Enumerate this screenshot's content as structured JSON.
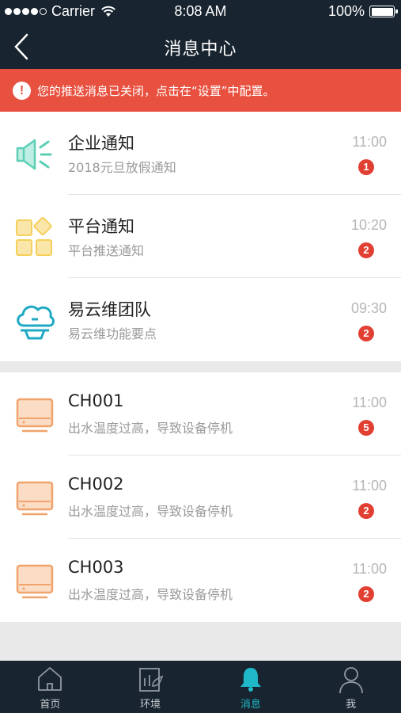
{
  "status_bar": {
    "carrier": "Carrier",
    "time": "8:08 AM",
    "battery": "100%",
    "battery_level": 1.0
  },
  "nav": {
    "back_icon": "chevron-left-icon",
    "title": "消息中心"
  },
  "alert": {
    "icon": "exclamation-icon",
    "text": "您的推送消息已关闭，点击在“设置”中配置。",
    "color": "#e8503f"
  },
  "system_messages": [
    {
      "icon": "megaphone-icon",
      "title": "企业通知",
      "subtitle": "2018元旦放假通知",
      "time": "11:00",
      "badge": "1"
    },
    {
      "icon": "grid-icon",
      "title": "平台通知",
      "subtitle": "平台推送通知",
      "time": "10:20",
      "badge": "2"
    },
    {
      "icon": "cloud-icon",
      "title": "易云维团队",
      "subtitle": "易云维功能要点",
      "time": "09:30",
      "badge": "2"
    }
  ],
  "device_messages": [
    {
      "icon": "device-icon",
      "title": "CH001",
      "subtitle": "出水温度过高，导致设备停机",
      "time": "11:00",
      "badge": "5"
    },
    {
      "icon": "device-icon",
      "title": "CH002",
      "subtitle": "出水温度过高，导致设备停机",
      "time": "11:00",
      "badge": "2"
    },
    {
      "icon": "device-icon",
      "title": "CH003",
      "subtitle": "出水温度过高，导致设备停机",
      "time": "11:00",
      "badge": "2"
    }
  ],
  "tabs": [
    {
      "label": "首页",
      "icon": "home-icon",
      "active": false
    },
    {
      "label": "环境",
      "icon": "environment-icon",
      "active": false
    },
    {
      "label": "消息",
      "icon": "bell-icon",
      "active": true
    },
    {
      "label": "我",
      "icon": "user-icon",
      "active": false
    }
  ],
  "colors": {
    "nav_bg": "#18242f",
    "accent": "#1fb8c9",
    "badge": "#e23f33",
    "megaphone": "#5ccfb6",
    "grid": "#f5cf5b",
    "device": "#f0a36b"
  }
}
